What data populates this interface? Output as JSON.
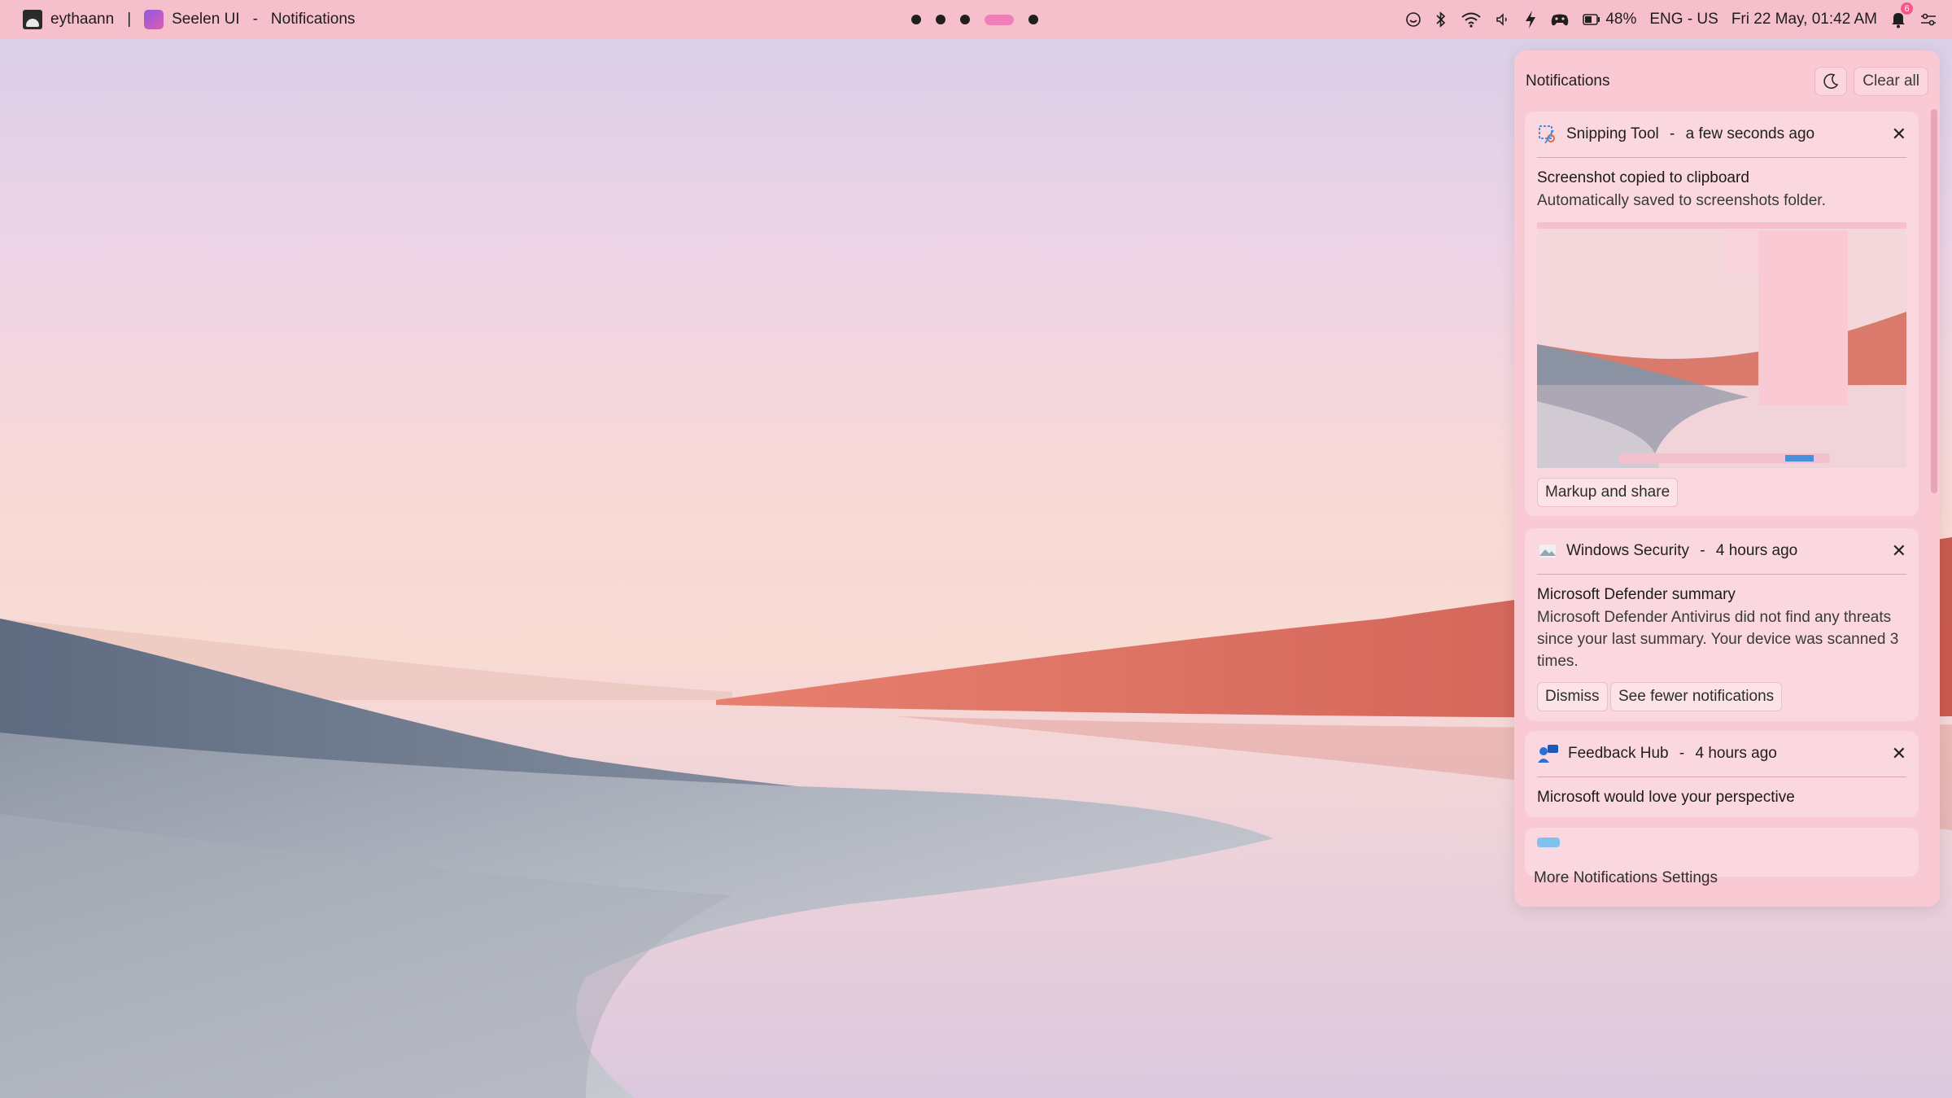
{
  "topbar": {
    "user": "eythaann",
    "divider": "|",
    "app_name": "Seelen UI",
    "dash": "-",
    "window_title": "Notifications",
    "workspaces": [
      {
        "active": false
      },
      {
        "active": false
      },
      {
        "active": false
      },
      {
        "active": true
      },
      {
        "active": false
      }
    ],
    "battery": "48%",
    "language": "ENG - US",
    "datetime": "Fri 22 May, 01:42 AM",
    "notification_count": "6",
    "icons": [
      "smile-icon",
      "bluetooth-icon",
      "wifi-icon",
      "volume-icon",
      "power-icon",
      "gamepad-icon",
      "battery-icon",
      "bell-icon",
      "settings-toggle-icon"
    ]
  },
  "panel": {
    "title": "Notifications",
    "dnd_icon": "moon-icon",
    "clear_all": "Clear all",
    "footer": "More Notifications Settings"
  },
  "notifications": [
    {
      "app": "Snipping Tool",
      "sep": "-",
      "time": "a few seconds ago",
      "title": "Screenshot copied to clipboard",
      "body": "Automatically saved to screenshots folder.",
      "actions": [
        "Markup and share"
      ]
    },
    {
      "app": "Windows Security",
      "sep": "-",
      "time": "4 hours ago",
      "title": "Microsoft Defender summary",
      "body": "Microsoft Defender Antivirus did not find any threats since your last summary. Your device was scanned 3 times.",
      "actions": [
        "Dismiss",
        "See fewer notifications"
      ]
    },
    {
      "app": "Feedback Hub",
      "sep": "-",
      "time": "4 hours ago",
      "title": "Microsoft would love your perspective"
    }
  ],
  "colors": {
    "topbar": "#f6bfcc",
    "panel": "#f9c9d4",
    "card": "#fbd7df",
    "active_workspace": "#f07fb8"
  }
}
